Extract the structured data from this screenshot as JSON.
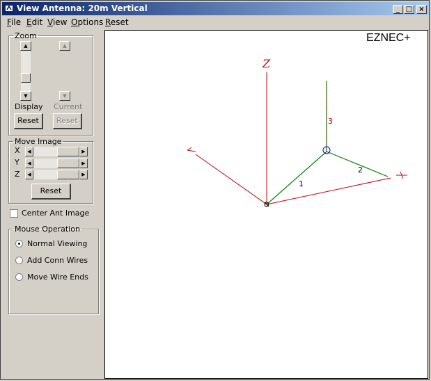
{
  "window": {
    "title": "View Antenna: 20m Vertical",
    "min_glyph": "_",
    "max_glyph": "□",
    "close_glyph": "×"
  },
  "menu": [
    {
      "label": "File"
    },
    {
      "label": "Edit"
    },
    {
      "label": "View"
    },
    {
      "label": "Options"
    },
    {
      "label": "Reset"
    }
  ],
  "zoom": {
    "legend": "Zoom",
    "display_label": "Display",
    "current_label": "Current",
    "display_reset": "Reset",
    "current_reset": "Reset"
  },
  "move_image": {
    "legend": "Move Image",
    "axes": [
      "X",
      "Y",
      "Z"
    ],
    "reset": "Reset"
  },
  "center_ant_image": {
    "label": "Center Ant Image",
    "checked": false
  },
  "mouse_operation": {
    "legend": "Mouse Operation",
    "options": [
      {
        "label": "Normal Viewing",
        "selected": true
      },
      {
        "label": "Add Conn Wires",
        "selected": false
      },
      {
        "label": "Move Wire Ends",
        "selected": false
      }
    ]
  },
  "canvas": {
    "brand": "EZNEC+",
    "axis_labels": {
      "z": "Z",
      "x": "X",
      "y": "Y"
    },
    "wire_labels": [
      "1",
      "2",
      "3"
    ],
    "axis_color": "#cc0000",
    "wire_color": "#008000"
  }
}
